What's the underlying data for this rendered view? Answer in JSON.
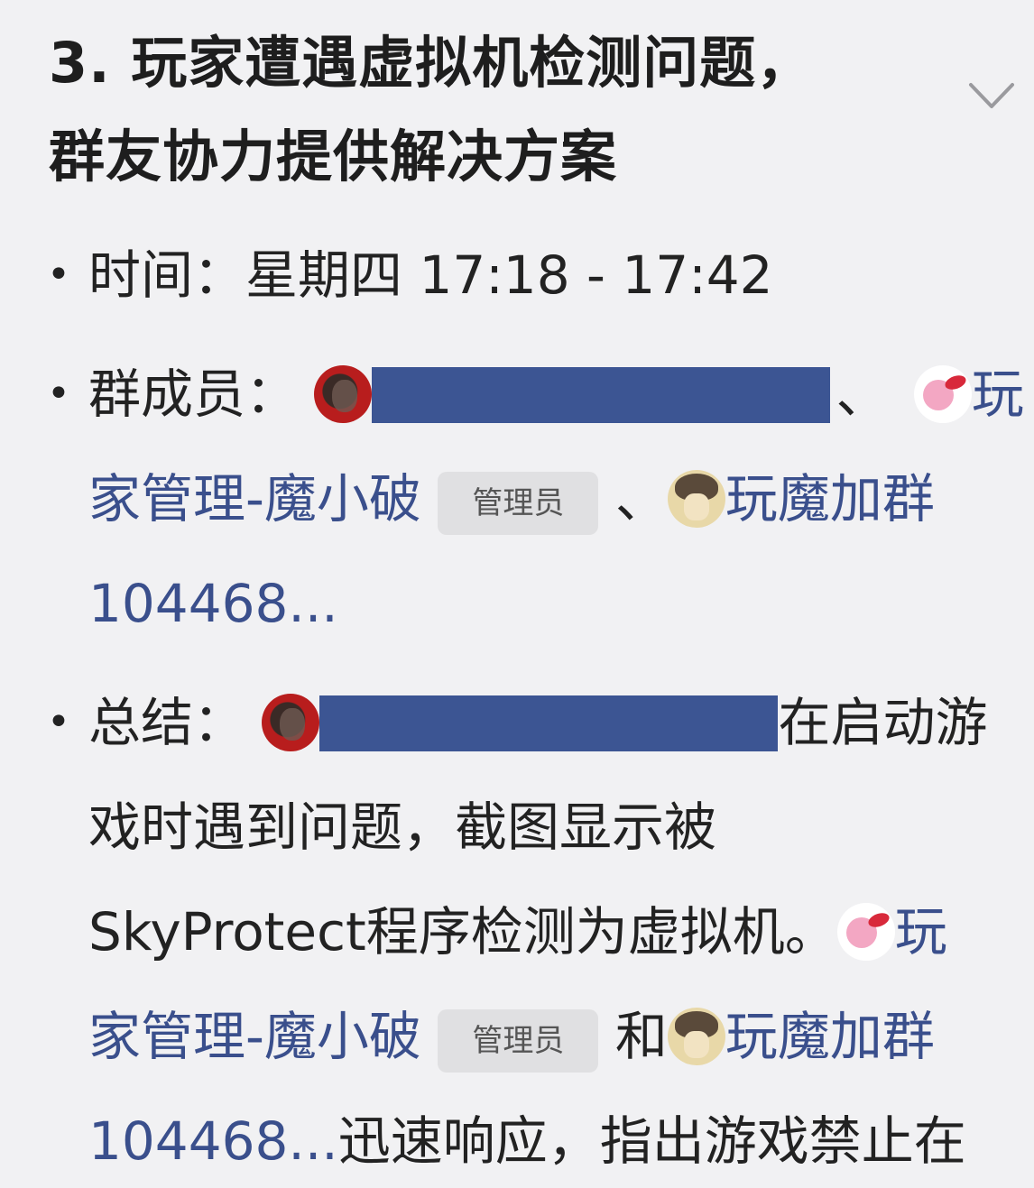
{
  "title": "3. 玩家遭遇虚拟机检测问题，群友协力提供解决方案",
  "title_line1": "3. 玩家遭遇虚拟机检测问题，",
  "title_line2": "群友协力提供解决方案",
  "bullet": "•",
  "time": {
    "label": "时间：",
    "value": "星期四 17:18 - 17:42"
  },
  "members": {
    "label": "群成员：",
    "sep1": "、",
    "m2_a": "玩",
    "m2_b": "家管理-魔小破",
    "badge": "管理员",
    "sep2": "、",
    "m3_a": "玩魔加群",
    "m3_b": "104468..."
  },
  "summary": {
    "label": "总结：",
    "t1": "在启动游",
    "t2": "戏时遇到问题，截图显示被",
    "t3": "SkyProtect程序检测为虚拟机。",
    "m2_a": "玩",
    "m2_b": "家管理-魔小破",
    "badge": "管理员",
    "and": "和",
    "m3_a": "玩魔加群",
    "m3_b": "104468...",
    "t4": "迅速响应，指出游戏禁止在"
  },
  "colors": {
    "mention": "#3a4f8c",
    "redaction": "#3c5593",
    "background": "#f1f1f3"
  },
  "icons": [
    "chevron-down-icon",
    "avatar-red",
    "avatar-kirby",
    "avatar-anime"
  ]
}
